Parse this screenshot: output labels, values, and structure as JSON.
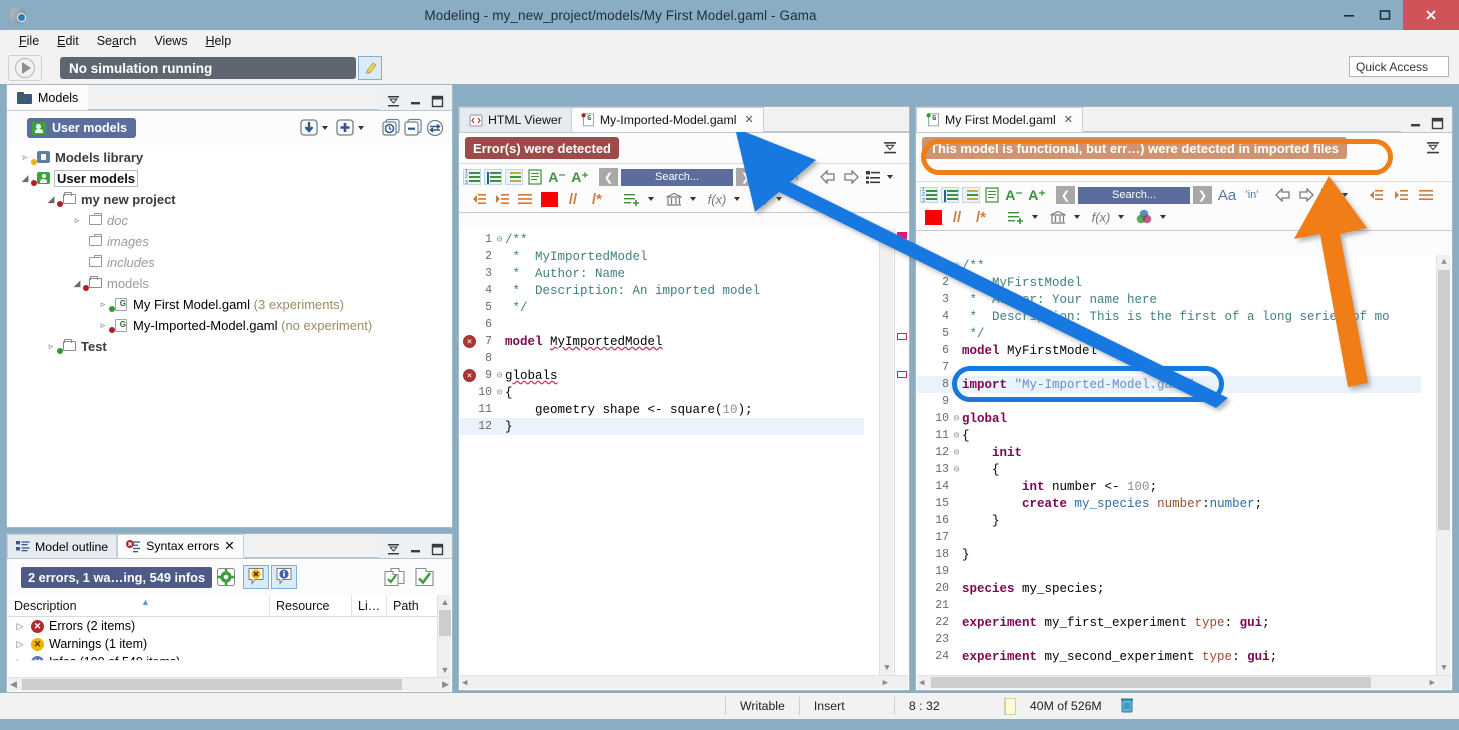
{
  "window": {
    "title": "Modeling - my_new_project/models/My First Model.gaml - Gama",
    "minimize": "–",
    "maximize": "❐",
    "close": "✕"
  },
  "menu": {
    "items": [
      "File",
      "Edit",
      "Search",
      "Views",
      "Help"
    ]
  },
  "toolbar": {
    "simulation_status": "No simulation running",
    "quick_access_placeholder": "Quick Access",
    "quick_access_value": "Quick Access"
  },
  "explorer": {
    "tab_label": "Models",
    "badge": "User models",
    "tree": [
      {
        "label": "Models library",
        "indent": 0,
        "arrow": "▹",
        "icon": "library-locked-icon",
        "style": "bold-grey",
        "dot": "yellow"
      },
      {
        "label": "User models",
        "indent": 0,
        "arrow": "◢",
        "icon": "library-user-icon",
        "style": "bold-black-selected",
        "dot": "red"
      },
      {
        "label": "my new project",
        "indent": 1,
        "arrow": "◢",
        "icon": "folder-icon",
        "style": "bold-grey",
        "dot": "red"
      },
      {
        "label": "doc",
        "indent": 2,
        "arrow": "▹",
        "icon": "case-icon",
        "style": "italic-grey",
        "dot": "none"
      },
      {
        "label": "images",
        "indent": 2,
        "arrow": "",
        "icon": "case-icon",
        "style": "italic-grey",
        "dot": "none"
      },
      {
        "label": "includes",
        "indent": 2,
        "arrow": "",
        "icon": "case-icon",
        "style": "italic-grey",
        "dot": "none"
      },
      {
        "label": "models",
        "indent": 2,
        "arrow": "◢",
        "icon": "folder-icon",
        "style": "grey",
        "dot": "red"
      },
      {
        "label": "My First Model.gaml",
        "sub": "(3 experiments)",
        "indent": 3,
        "arrow": "▹",
        "icon": "gaml-file-icon",
        "style": "normal",
        "dot": "green"
      },
      {
        "label": "My-Imported-Model.gaml",
        "sub": "(no experiment)",
        "indent": 3,
        "arrow": "▹",
        "icon": "gaml-file-icon",
        "style": "normal",
        "dot": "red"
      },
      {
        "label": "Test",
        "indent": 1,
        "arrow": "▹",
        "icon": "folder-icon",
        "style": "bold-grey",
        "dot": "green"
      }
    ]
  },
  "problems": {
    "tabs": [
      {
        "label": "Model outline",
        "icon": "outline-icon",
        "active": false,
        "closeable": false
      },
      {
        "label": "Syntax errors",
        "icon": "error-outline-icon",
        "active": true,
        "closeable": true
      }
    ],
    "summary": "2 errors, 1 wa…ing, 549 infos",
    "columns": [
      "Description",
      "Resource",
      "Li…",
      "Path"
    ],
    "rows": [
      {
        "label": "Errors (2 items)",
        "severity": "error"
      },
      {
        "label": "Warnings (1 item)",
        "severity": "warning"
      },
      {
        "label": "Infos (100 of 549 items)",
        "severity": "info"
      }
    ]
  },
  "editor_center": {
    "tabs": [
      {
        "label": "HTML Viewer",
        "icon": "html-viewer-icon",
        "active": false,
        "closeable": false
      },
      {
        "label": "My-Imported-Model.gaml",
        "icon": "gaml-file-icon",
        "active": true,
        "closeable": true
      }
    ],
    "banner": "Error(s) were detected",
    "search_placeholder": "Search...",
    "lines": [
      {
        "n": "1",
        "fold": "⊖",
        "marker": "",
        "html": "<span class='cm'>/**</span>"
      },
      {
        "n": "2",
        "fold": "",
        "marker": "",
        "html": "<span class='cm'> *  MyImportedModel</span>"
      },
      {
        "n": "3",
        "fold": "",
        "marker": "",
        "html": "<span class='cm'> *  Author: Name</span>"
      },
      {
        "n": "4",
        "fold": "",
        "marker": "",
        "html": "<span class='cm'> *  Description: An imported model</span>"
      },
      {
        "n": "5",
        "fold": "",
        "marker": "",
        "html": "<span class='cm'> */</span>"
      },
      {
        "n": "6",
        "fold": "",
        "marker": "",
        "html": ""
      },
      {
        "n": "7",
        "fold": "",
        "marker": "error",
        "html": "<span class='kw'>model</span> <span class='sq'>MyImportedModel</span>"
      },
      {
        "n": "8",
        "fold": "",
        "marker": "",
        "html": ""
      },
      {
        "n": "9",
        "fold": "⊖",
        "marker": "error",
        "html": "<span class='sq'>globals</span>"
      },
      {
        "n": "10",
        "fold": "⊖",
        "marker": "",
        "html": "{"
      },
      {
        "n": "11",
        "fold": "",
        "marker": "",
        "html": "    geometry shape &lt;- square(<span class='num'>10</span>);"
      },
      {
        "n": "12",
        "fold": "",
        "marker": "",
        "html": "}",
        "highlight": true
      }
    ]
  },
  "editor_right": {
    "tabs": [
      {
        "label": "My First Model.gaml",
        "icon": "gaml-file-icon",
        "active": true,
        "closeable": true
      }
    ],
    "banner": "This model is functional, but err…) were detected in imported files",
    "search_placeholder": "Search...",
    "lines": [
      {
        "n": "1",
        "fold": "⊖",
        "html": "<span class='cm'>/**</span>"
      },
      {
        "n": "2",
        "fold": "",
        "html": "<span class='cm'> *  MyFirstModel</span>"
      },
      {
        "n": "3",
        "fold": "",
        "html": "<span class='cm'> *  Author: Your name here</span>"
      },
      {
        "n": "4",
        "fold": "",
        "html": "<span class='cm'> *  Description: This is the first of a long series of mo</span>"
      },
      {
        "n": "5",
        "fold": "",
        "html": "<span class='cm'> */</span>"
      },
      {
        "n": "6",
        "fold": "",
        "html": "<span class='kw'>model</span> MyFirstModel"
      },
      {
        "n": "7",
        "fold": "",
        "html": ""
      },
      {
        "n": "8",
        "fold": "",
        "html": "<span class='kw'>import</span> <span class='str'>\"My-Imported-Model.gaml\"</span>",
        "highlight": true
      },
      {
        "n": "9",
        "fold": "",
        "html": ""
      },
      {
        "n": "10",
        "fold": "⊖",
        "html": "<span class='kw'>global</span>"
      },
      {
        "n": "11",
        "fold": "⊖",
        "html": "{"
      },
      {
        "n": "12",
        "fold": "⊖",
        "html": "    <span class='kw'>init</span>"
      },
      {
        "n": "13",
        "fold": "⊖",
        "html": "    {"
      },
      {
        "n": "14",
        "fold": "",
        "html": "        <span class='kw'>int</span> number &lt;- <span class='num'>100</span>;"
      },
      {
        "n": "15",
        "fold": "",
        "html": "        <span class='kw'>create</span> <span class='typ'>my_species</span> <span class='fac'>number</span>:<span class='typ'>number</span>;"
      },
      {
        "n": "16",
        "fold": "",
        "html": "    }"
      },
      {
        "n": "17",
        "fold": "",
        "html": ""
      },
      {
        "n": "18",
        "fold": "",
        "html": "}"
      },
      {
        "n": "19",
        "fold": "",
        "html": ""
      },
      {
        "n": "20",
        "fold": "",
        "html": "<span class='kw'>species</span> my_species;"
      },
      {
        "n": "21",
        "fold": "",
        "html": ""
      },
      {
        "n": "22",
        "fold": "",
        "html": "<span class='kw'>experiment</span> my_first_experiment <span class='fac'>type</span>: <span class='kw'>gui</span>;"
      },
      {
        "n": "23",
        "fold": "",
        "html": ""
      },
      {
        "n": "24",
        "fold": "",
        "html": "<span class='kw'>experiment</span> my_second_experiment <span class='fac'>type</span>: <span class='kw'>gui</span>;"
      }
    ]
  },
  "statusbar": {
    "writable": "Writable",
    "insert": "Insert",
    "position": "8 : 32",
    "memory": "40M of 526M"
  },
  "colors": {
    "titlebar": "#8badc3",
    "accent_blue": "#1878e0",
    "accent_orange": "#f07d18",
    "error_pill": "#9c4a4a",
    "warn_pill": "#d09470",
    "badge_blue": "#5a6d9c"
  }
}
